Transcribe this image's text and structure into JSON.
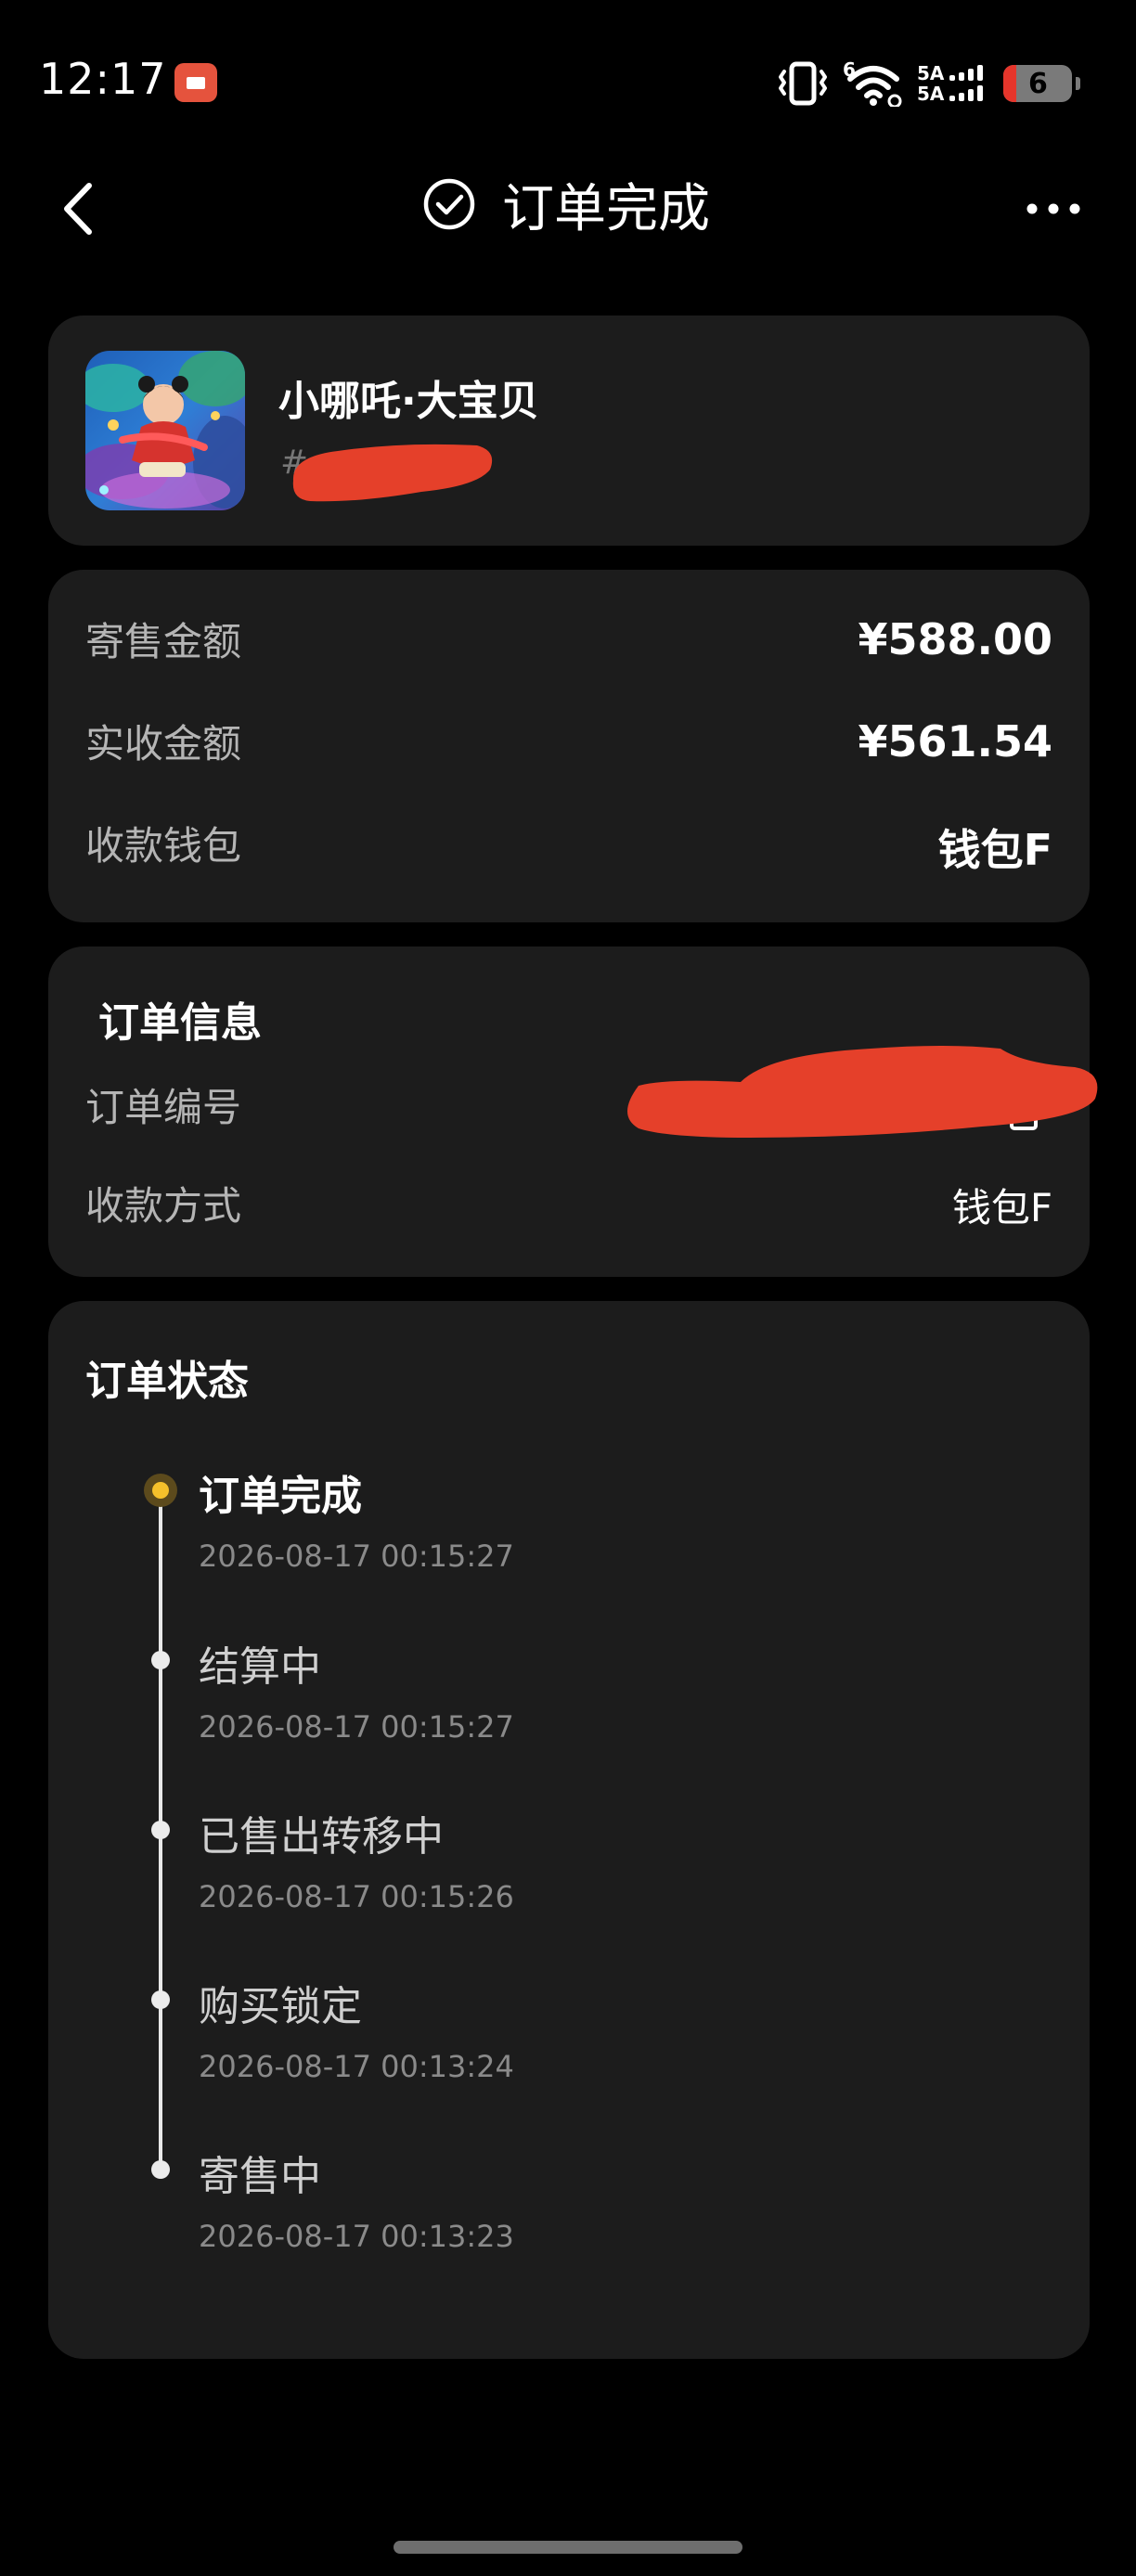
{
  "status_bar": {
    "time": "12:17",
    "battery_level": "6",
    "network_labels": [
      "5A",
      "5A"
    ],
    "wifi_superscript": "6",
    "icons": [
      "notification-app-icon",
      "vibrate-icon",
      "wifi-icon",
      "cellular-signal-icon",
      "battery-icon"
    ]
  },
  "nav": {
    "title": "订单完成",
    "back_icon": "chevron-left-icon",
    "title_icon": "check-circle-icon",
    "more_icon": "more-horizontal-icon"
  },
  "product": {
    "name": "小哪吒·大宝贝",
    "id_prefix": "#"
  },
  "amounts": {
    "rows": [
      {
        "label": "寄售金额",
        "value": "¥588.00"
      },
      {
        "label": "实收金额",
        "value": "¥561.54"
      },
      {
        "label": "收款钱包",
        "value": "钱包F"
      }
    ]
  },
  "order_info": {
    "title": "订单信息",
    "order_no_label": "订单编号",
    "pay_method_label": "收款方式",
    "pay_method_value": "钱包F",
    "copy_icon": "copy-icon"
  },
  "order_status": {
    "title": "订单状态",
    "steps": [
      {
        "status": "订单完成",
        "time": "2026-08-17 00:15:27",
        "active": true
      },
      {
        "status": "结算中",
        "time": "2026-08-17 00:15:27",
        "active": false
      },
      {
        "status": "已售出转移中",
        "time": "2026-08-17 00:15:26",
        "active": false
      },
      {
        "status": "购买锁定",
        "time": "2026-08-17 00:13:24",
        "active": false
      },
      {
        "status": "寄售中",
        "time": "2026-08-17 00:13:23",
        "active": false
      }
    ]
  },
  "colors": {
    "background": "#000000",
    "card": "#1c1c1c",
    "accent_dot": "#f5c02b",
    "redaction": "#e5402a",
    "status_badge": "#e5533d"
  }
}
